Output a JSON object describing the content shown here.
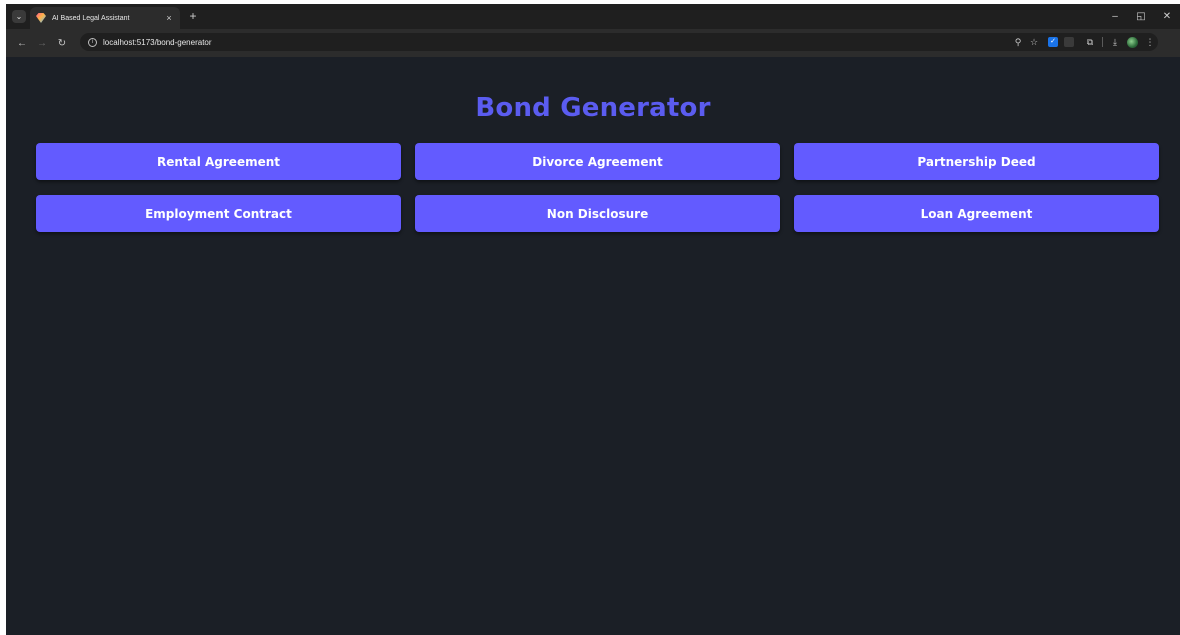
{
  "browser": {
    "tab_title": "AI Based Legal Assistant",
    "tab_close": "×",
    "new_tab": "+",
    "url": "localhost:5173/bond-generator",
    "icons": {
      "tab_search": "chevron-down-icon",
      "minimize": "minimize-icon",
      "restore": "restore-icon",
      "close": "close-icon",
      "back": "back-arrow-icon",
      "forward": "forward-arrow-icon",
      "reload": "reload-icon",
      "site_info": "info-icon",
      "zoom": "zoom-icon",
      "bookmark": "star-icon",
      "extension": "extension-icon",
      "puzzle": "puzzle-icon",
      "download": "download-icon",
      "profile": "avatar",
      "menu": "kebab-menu-icon"
    }
  },
  "page": {
    "title": "Bond Generator",
    "accent_color": "#5b5cf0",
    "button_color": "#635bff",
    "background_color": "#1b1f26",
    "buttons": [
      {
        "label": "Rental Agreement"
      },
      {
        "label": "Divorce Agreement"
      },
      {
        "label": "Partnership Deed"
      },
      {
        "label": "Employment Contract"
      },
      {
        "label": "Non Disclosure"
      },
      {
        "label": "Loan Agreement"
      }
    ]
  }
}
